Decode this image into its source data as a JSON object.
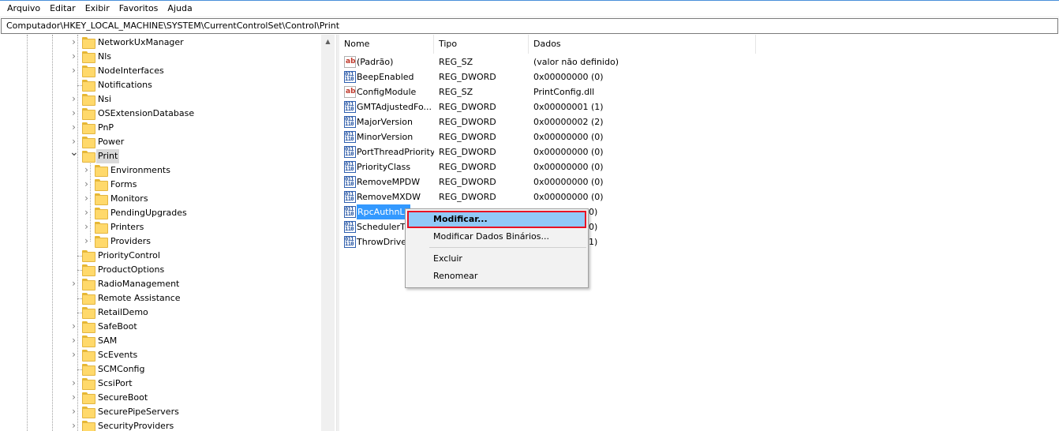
{
  "menu": [
    "Arquivo",
    "Editar",
    "Exibir",
    "Favoritos",
    "Ajuda"
  ],
  "address": "Computador\\HKEY_LOCAL_MACHINE\\SYSTEM\\CurrentControlSet\\Control\\Print",
  "tree": {
    "items": [
      {
        "label": "NetworkUxManager",
        "level": 1,
        "expander": "collapsed"
      },
      {
        "label": "Nls",
        "level": 1,
        "expander": "collapsed"
      },
      {
        "label": "NodeInterfaces",
        "level": 1,
        "expander": "collapsed"
      },
      {
        "label": "Notifications",
        "level": 1,
        "expander": "none"
      },
      {
        "label": "Nsi",
        "level": 1,
        "expander": "collapsed"
      },
      {
        "label": "OSExtensionDatabase",
        "level": 1,
        "expander": "collapsed"
      },
      {
        "label": "PnP",
        "level": 1,
        "expander": "collapsed"
      },
      {
        "label": "Power",
        "level": 1,
        "expander": "collapsed"
      },
      {
        "label": "Print",
        "level": 1,
        "expander": "expanded",
        "selected": true
      },
      {
        "label": "Environments",
        "level": 2,
        "expander": "collapsed"
      },
      {
        "label": "Forms",
        "level": 2,
        "expander": "collapsed"
      },
      {
        "label": "Monitors",
        "level": 2,
        "expander": "collapsed"
      },
      {
        "label": "PendingUpgrades",
        "level": 2,
        "expander": "collapsed"
      },
      {
        "label": "Printers",
        "level": 2,
        "expander": "collapsed"
      },
      {
        "label": "Providers",
        "level": 2,
        "expander": "collapsed"
      },
      {
        "label": "PriorityControl",
        "level": 1,
        "expander": "none"
      },
      {
        "label": "ProductOptions",
        "level": 1,
        "expander": "none"
      },
      {
        "label": "RadioManagement",
        "level": 1,
        "expander": "collapsed"
      },
      {
        "label": "Remote Assistance",
        "level": 1,
        "expander": "none"
      },
      {
        "label": "RetailDemo",
        "level": 1,
        "expander": "none"
      },
      {
        "label": "SafeBoot",
        "level": 1,
        "expander": "collapsed"
      },
      {
        "label": "SAM",
        "level": 1,
        "expander": "collapsed"
      },
      {
        "label": "ScEvents",
        "level": 1,
        "expander": "collapsed"
      },
      {
        "label": "SCMConfig",
        "level": 1,
        "expander": "none"
      },
      {
        "label": "ScsiPort",
        "level": 1,
        "expander": "collapsed"
      },
      {
        "label": "SecureBoot",
        "level": 1,
        "expander": "collapsed"
      },
      {
        "label": "SecurePipeServers",
        "level": 1,
        "expander": "collapsed"
      },
      {
        "label": "SecurityProviders",
        "level": 1,
        "expander": "collapsed"
      }
    ]
  },
  "columns": {
    "name": "Nome",
    "type": "Tipo",
    "data": "Dados"
  },
  "values": [
    {
      "name": "(Padrão)",
      "type": "REG_SZ",
      "data": "(valor não definido)",
      "icon": "string-value-icon"
    },
    {
      "name": "BeepEnabled",
      "type": "REG_DWORD",
      "data": "0x00000000 (0)",
      "icon": "dword-value-icon"
    },
    {
      "name": "ConfigModule",
      "type": "REG_SZ",
      "data": "PrintConfig.dll",
      "icon": "string-value-icon"
    },
    {
      "name": "GMTAdjustedFo...",
      "type": "REG_DWORD",
      "data": "0x00000001 (1)",
      "icon": "dword-value-icon"
    },
    {
      "name": "MajorVersion",
      "type": "REG_DWORD",
      "data": "0x00000002 (2)",
      "icon": "dword-value-icon"
    },
    {
      "name": "MinorVersion",
      "type": "REG_DWORD",
      "data": "0x00000000 (0)",
      "icon": "dword-value-icon"
    },
    {
      "name": "PortThreadPriority",
      "type": "REG_DWORD",
      "data": "0x00000000 (0)",
      "icon": "dword-value-icon"
    },
    {
      "name": "PriorityClass",
      "type": "REG_DWORD",
      "data": "0x00000000 (0)",
      "icon": "dword-value-icon"
    },
    {
      "name": "RemoveMPDW",
      "type": "REG_DWORD",
      "data": "0x00000000 (0)",
      "icon": "dword-value-icon"
    },
    {
      "name": "RemoveMXDW",
      "type": "REG_DWORD",
      "data": "0x00000000 (0)",
      "icon": "dword-value-icon"
    },
    {
      "name": "RpcAuthnLe",
      "type": "",
      "data": "0)",
      "icon": "dword-value-icon",
      "highlighted": true
    },
    {
      "name": "SchedulerTh",
      "type": "",
      "data": "0)",
      "icon": "dword-value-icon"
    },
    {
      "name": "ThrowDriver",
      "type": "",
      "data": "1)",
      "icon": "dword-value-icon"
    }
  ],
  "context_menu": {
    "items": [
      "Modificar...",
      "Modificar Dados Binários...",
      "Excluir",
      "Renomear"
    ],
    "active_item": "Modificar...",
    "highlight_border_color": "#e81123"
  },
  "icons": {
    "string": "ab",
    "dword": "011 110"
  }
}
